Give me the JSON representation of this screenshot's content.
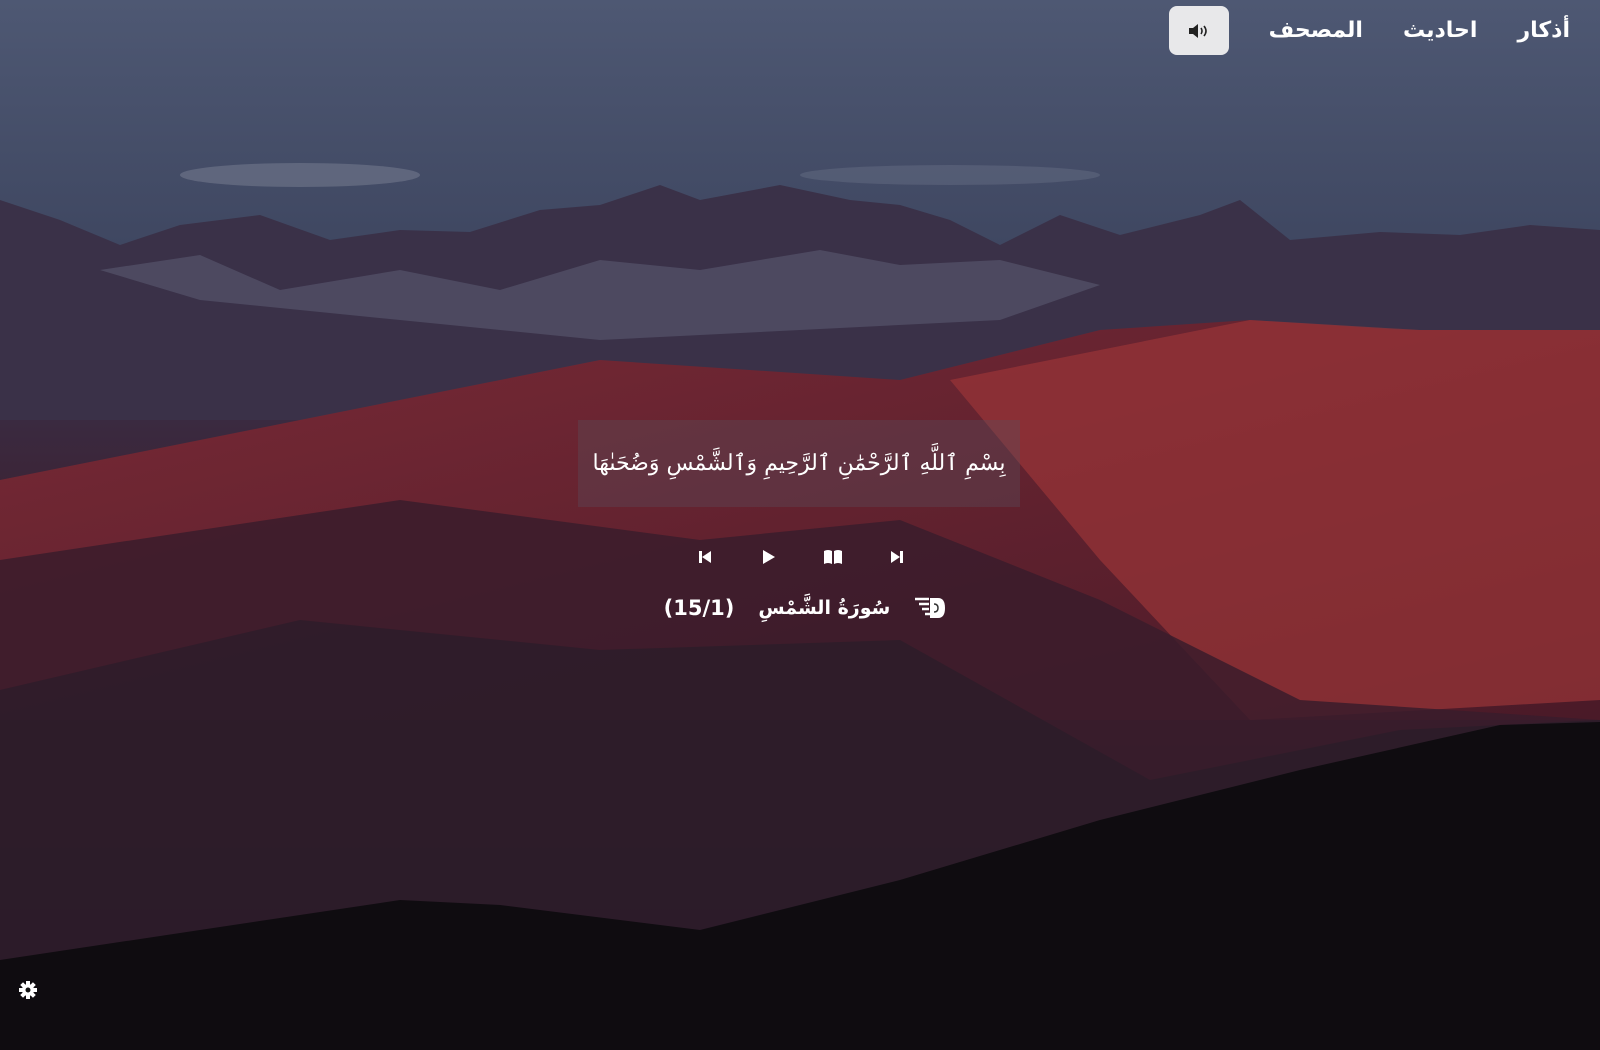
{
  "nav": {
    "sound_icon": "speaker-icon",
    "links": [
      "أذكار",
      "احاديث",
      "المصحف"
    ]
  },
  "ayah": {
    "text": "بِسْمِ ٱللَّهِ ٱلرَّحْمَٰنِ ٱلرَّحِيمِ وَٱلشَّمْسِ وَضُحَىٰهَا"
  },
  "player": {
    "icons": [
      "previous-icon",
      "play-icon",
      "book-icon",
      "next-icon"
    ]
  },
  "surah": {
    "icon": "hand-pointing-icon",
    "name": "سُورَةُ الشَّمْسِ",
    "progress": "(15/1)"
  },
  "settings": {
    "icon": "gear-icon"
  }
}
